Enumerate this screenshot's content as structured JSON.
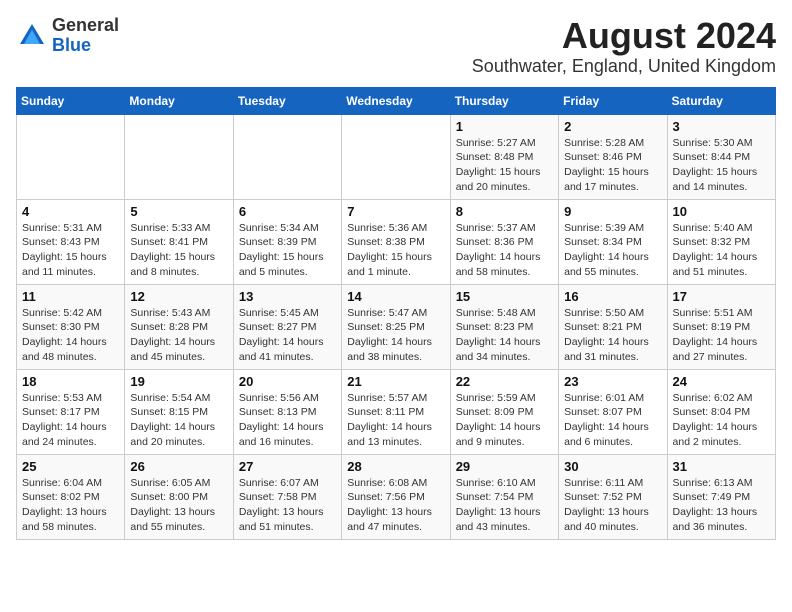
{
  "header": {
    "logo_general": "General",
    "logo_blue": "Blue",
    "title": "August 2024",
    "subtitle": "Southwater, England, United Kingdom"
  },
  "days_of_week": [
    "Sunday",
    "Monday",
    "Tuesday",
    "Wednesday",
    "Thursday",
    "Friday",
    "Saturday"
  ],
  "weeks": [
    [
      {
        "day": "",
        "sunrise": "",
        "sunset": "",
        "daylight": ""
      },
      {
        "day": "",
        "sunrise": "",
        "sunset": "",
        "daylight": ""
      },
      {
        "day": "",
        "sunrise": "",
        "sunset": "",
        "daylight": ""
      },
      {
        "day": "",
        "sunrise": "",
        "sunset": "",
        "daylight": ""
      },
      {
        "day": "1",
        "sunrise": "Sunrise: 5:27 AM",
        "sunset": "Sunset: 8:48 PM",
        "daylight": "Daylight: 15 hours and 20 minutes."
      },
      {
        "day": "2",
        "sunrise": "Sunrise: 5:28 AM",
        "sunset": "Sunset: 8:46 PM",
        "daylight": "Daylight: 15 hours and 17 minutes."
      },
      {
        "day": "3",
        "sunrise": "Sunrise: 5:30 AM",
        "sunset": "Sunset: 8:44 PM",
        "daylight": "Daylight: 15 hours and 14 minutes."
      }
    ],
    [
      {
        "day": "4",
        "sunrise": "Sunrise: 5:31 AM",
        "sunset": "Sunset: 8:43 PM",
        "daylight": "Daylight: 15 hours and 11 minutes."
      },
      {
        "day": "5",
        "sunrise": "Sunrise: 5:33 AM",
        "sunset": "Sunset: 8:41 PM",
        "daylight": "Daylight: 15 hours and 8 minutes."
      },
      {
        "day": "6",
        "sunrise": "Sunrise: 5:34 AM",
        "sunset": "Sunset: 8:39 PM",
        "daylight": "Daylight: 15 hours and 5 minutes."
      },
      {
        "day": "7",
        "sunrise": "Sunrise: 5:36 AM",
        "sunset": "Sunset: 8:38 PM",
        "daylight": "Daylight: 15 hours and 1 minute."
      },
      {
        "day": "8",
        "sunrise": "Sunrise: 5:37 AM",
        "sunset": "Sunset: 8:36 PM",
        "daylight": "Daylight: 14 hours and 58 minutes."
      },
      {
        "day": "9",
        "sunrise": "Sunrise: 5:39 AM",
        "sunset": "Sunset: 8:34 PM",
        "daylight": "Daylight: 14 hours and 55 minutes."
      },
      {
        "day": "10",
        "sunrise": "Sunrise: 5:40 AM",
        "sunset": "Sunset: 8:32 PM",
        "daylight": "Daylight: 14 hours and 51 minutes."
      }
    ],
    [
      {
        "day": "11",
        "sunrise": "Sunrise: 5:42 AM",
        "sunset": "Sunset: 8:30 PM",
        "daylight": "Daylight: 14 hours and 48 minutes."
      },
      {
        "day": "12",
        "sunrise": "Sunrise: 5:43 AM",
        "sunset": "Sunset: 8:28 PM",
        "daylight": "Daylight: 14 hours and 45 minutes."
      },
      {
        "day": "13",
        "sunrise": "Sunrise: 5:45 AM",
        "sunset": "Sunset: 8:27 PM",
        "daylight": "Daylight: 14 hours and 41 minutes."
      },
      {
        "day": "14",
        "sunrise": "Sunrise: 5:47 AM",
        "sunset": "Sunset: 8:25 PM",
        "daylight": "Daylight: 14 hours and 38 minutes."
      },
      {
        "day": "15",
        "sunrise": "Sunrise: 5:48 AM",
        "sunset": "Sunset: 8:23 PM",
        "daylight": "Daylight: 14 hours and 34 minutes."
      },
      {
        "day": "16",
        "sunrise": "Sunrise: 5:50 AM",
        "sunset": "Sunset: 8:21 PM",
        "daylight": "Daylight: 14 hours and 31 minutes."
      },
      {
        "day": "17",
        "sunrise": "Sunrise: 5:51 AM",
        "sunset": "Sunset: 8:19 PM",
        "daylight": "Daylight: 14 hours and 27 minutes."
      }
    ],
    [
      {
        "day": "18",
        "sunrise": "Sunrise: 5:53 AM",
        "sunset": "Sunset: 8:17 PM",
        "daylight": "Daylight: 14 hours and 24 minutes."
      },
      {
        "day": "19",
        "sunrise": "Sunrise: 5:54 AM",
        "sunset": "Sunset: 8:15 PM",
        "daylight": "Daylight: 14 hours and 20 minutes."
      },
      {
        "day": "20",
        "sunrise": "Sunrise: 5:56 AM",
        "sunset": "Sunset: 8:13 PM",
        "daylight": "Daylight: 14 hours and 16 minutes."
      },
      {
        "day": "21",
        "sunrise": "Sunrise: 5:57 AM",
        "sunset": "Sunset: 8:11 PM",
        "daylight": "Daylight: 14 hours and 13 minutes."
      },
      {
        "day": "22",
        "sunrise": "Sunrise: 5:59 AM",
        "sunset": "Sunset: 8:09 PM",
        "daylight": "Daylight: 14 hours and 9 minutes."
      },
      {
        "day": "23",
        "sunrise": "Sunrise: 6:01 AM",
        "sunset": "Sunset: 8:07 PM",
        "daylight": "Daylight: 14 hours and 6 minutes."
      },
      {
        "day": "24",
        "sunrise": "Sunrise: 6:02 AM",
        "sunset": "Sunset: 8:04 PM",
        "daylight": "Daylight: 14 hours and 2 minutes."
      }
    ],
    [
      {
        "day": "25",
        "sunrise": "Sunrise: 6:04 AM",
        "sunset": "Sunset: 8:02 PM",
        "daylight": "Daylight: 13 hours and 58 minutes."
      },
      {
        "day": "26",
        "sunrise": "Sunrise: 6:05 AM",
        "sunset": "Sunset: 8:00 PM",
        "daylight": "Daylight: 13 hours and 55 minutes."
      },
      {
        "day": "27",
        "sunrise": "Sunrise: 6:07 AM",
        "sunset": "Sunset: 7:58 PM",
        "daylight": "Daylight: 13 hours and 51 minutes."
      },
      {
        "day": "28",
        "sunrise": "Sunrise: 6:08 AM",
        "sunset": "Sunset: 7:56 PM",
        "daylight": "Daylight: 13 hours and 47 minutes."
      },
      {
        "day": "29",
        "sunrise": "Sunrise: 6:10 AM",
        "sunset": "Sunset: 7:54 PM",
        "daylight": "Daylight: 13 hours and 43 minutes."
      },
      {
        "day": "30",
        "sunrise": "Sunrise: 6:11 AM",
        "sunset": "Sunset: 7:52 PM",
        "daylight": "Daylight: 13 hours and 40 minutes."
      },
      {
        "day": "31",
        "sunrise": "Sunrise: 6:13 AM",
        "sunset": "Sunset: 7:49 PM",
        "daylight": "Daylight: 13 hours and 36 minutes."
      }
    ]
  ]
}
